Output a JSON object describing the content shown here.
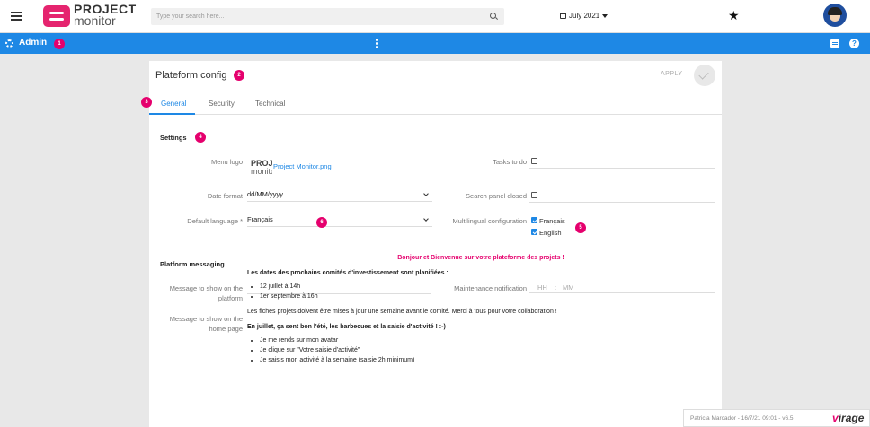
{
  "topbar": {
    "logo_line1": "PROJECT",
    "logo_line2": "monitor",
    "search_placeholder": "Type your search here...",
    "date_selector": "July 2021"
  },
  "adminbar": {
    "title": "Admin",
    "badge": "1"
  },
  "card": {
    "title": "Plateform config",
    "title_badge": "2",
    "apply_label": "APPLY",
    "tabs": [
      {
        "label": "General",
        "active": true
      },
      {
        "label": "Security",
        "active": false
      },
      {
        "label": "Technical",
        "active": false
      }
    ],
    "tabs_badge": "3"
  },
  "settings": {
    "title": "Settings",
    "badge": "4",
    "menu_logo_label": "Menu logo",
    "menu_logo_file": "Project Monitor.png",
    "tasks_label": "Tasks to do",
    "date_format_label": "Date format",
    "date_format_value": "dd/MM/yyyy",
    "search_panel_label": "Search panel closed",
    "default_language_label": "Default language *",
    "default_language_value": "Français",
    "language_badge": "6",
    "multilingual_label": "Multilingual configuration",
    "multilingual_options": [
      {
        "label": "Français",
        "checked": true
      },
      {
        "label": "English",
        "checked": true
      }
    ],
    "multilingual_badge": "5"
  },
  "messaging": {
    "title": "Platform messaging",
    "platform_message_label_1": "Message to show on the",
    "platform_message_label_2": "platform",
    "maintenance_label": "Maintenance notification",
    "maintenance_hh": "HH",
    "maintenance_mm": "MM",
    "home_message_label_1": "Message to show on the",
    "home_message_label_2": "home page",
    "home_message": {
      "headline": "Bonjour et Bienvenue sur votre plateforme des projets !",
      "para1": "Les dates des prochains comités d'investissement sont planifiées :",
      "list1": [
        "12 juillet à 14h",
        "1er septembre à 16h"
      ],
      "para2": "Les fiches projets doivent être mises à jour une semaine avant le comité. Merci à tous pour votre collaboration !",
      "para3": "En juillet, ça sent bon l'été, les barbecues et la saisie d'activité ! :-)",
      "list2": [
        "Je me rends sur mon avatar",
        "Je clique sur \"Votre saisie d'activité\"",
        "Je saisis mon activité à la semaine (saisie 2h minimum)"
      ]
    }
  },
  "footer": {
    "text": "Patricia Marcador - 16/7/21 09:01 - v6.5",
    "brand_v": "v",
    "brand_rest": "irage"
  },
  "colors": {
    "primary": "#1e88e5",
    "accent": "#e5006d",
    "logo": "#e5246f"
  }
}
